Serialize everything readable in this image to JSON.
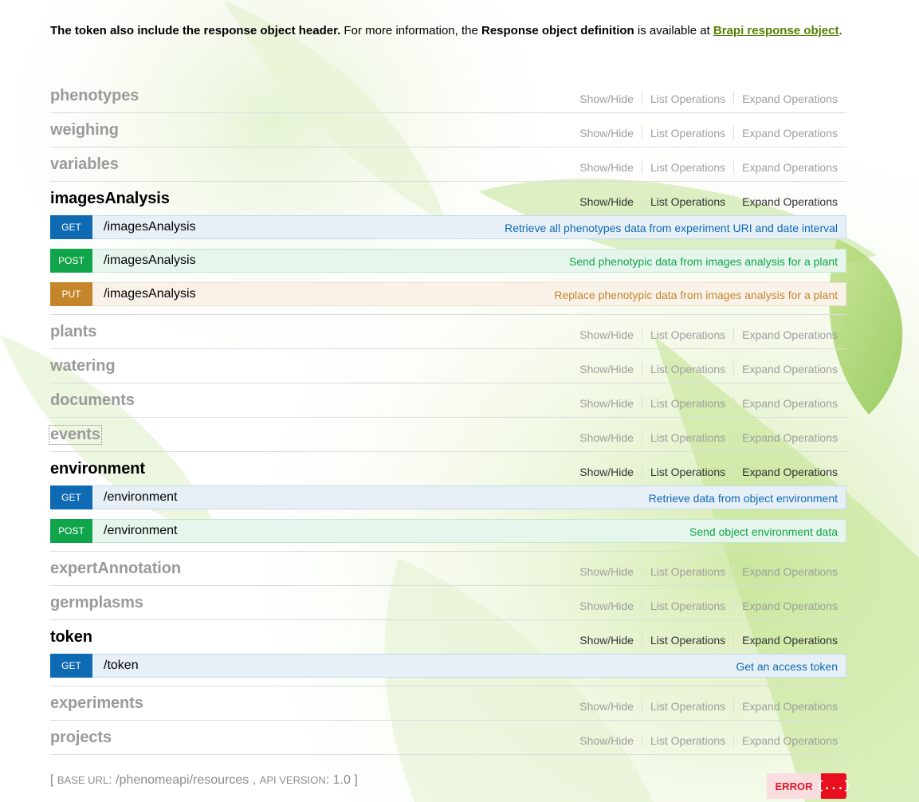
{
  "intro": {
    "part1": "The token also include the response object header.",
    "part2": " For more information, the ",
    "part3": "Response object definition",
    "part4": " is available at ",
    "link": "Brapi response object",
    "part5": "."
  },
  "ops_labels": {
    "show_hide": "Show/Hide",
    "list_operations": "List Operations",
    "expand_operations": "Expand Operations"
  },
  "resources": [
    {
      "name": "phenotypes",
      "open": false
    },
    {
      "name": "weighing",
      "open": false
    },
    {
      "name": "variables",
      "open": false
    },
    {
      "name": "imagesAnalysis",
      "open": true,
      "operations": [
        {
          "method": "GET",
          "path": "/imagesAnalysis",
          "summary": "Retrieve all phenotypes data from experiment URI and date interval"
        },
        {
          "method": "POST",
          "path": "/imagesAnalysis",
          "summary": "Send phenotypic data from images analysis for a plant"
        },
        {
          "method": "PUT",
          "path": "/imagesAnalysis",
          "summary": "Replace phenotypic data from images analysis for a plant"
        }
      ]
    },
    {
      "name": "plants",
      "open": false
    },
    {
      "name": "watering",
      "open": false
    },
    {
      "name": "documents",
      "open": false
    },
    {
      "name": "events",
      "open": false
    },
    {
      "name": "environment",
      "open": true,
      "operations": [
        {
          "method": "GET",
          "path": "/environment",
          "summary": "Retrieve data from object environment"
        },
        {
          "method": "POST",
          "path": "/environment",
          "summary": "Send object environment data"
        }
      ]
    },
    {
      "name": "expertAnnotation",
      "open": false
    },
    {
      "name": "germplasms",
      "open": false
    },
    {
      "name": "token",
      "open": true,
      "operations": [
        {
          "method": "GET",
          "path": "/token",
          "summary": "Get an access token"
        }
      ]
    },
    {
      "name": "experiments",
      "open": false
    },
    {
      "name": "projects",
      "open": false
    }
  ],
  "footer": {
    "open_bracket": "[ ",
    "base_url_label": "Base URL",
    "base_url": ": /phenomeapi/resources",
    "sep": " , ",
    "api_version_label": "Api Version",
    "api_version": ": 1.0",
    "close_bracket": " ]"
  },
  "validator": {
    "label": "ERROR",
    "icon_glyph": "{...}"
  },
  "colors": {
    "get": "#0f6ab4",
    "post": "#10a54a",
    "put": "#c5862b",
    "link": "#547f00",
    "error": "#e8101e"
  }
}
